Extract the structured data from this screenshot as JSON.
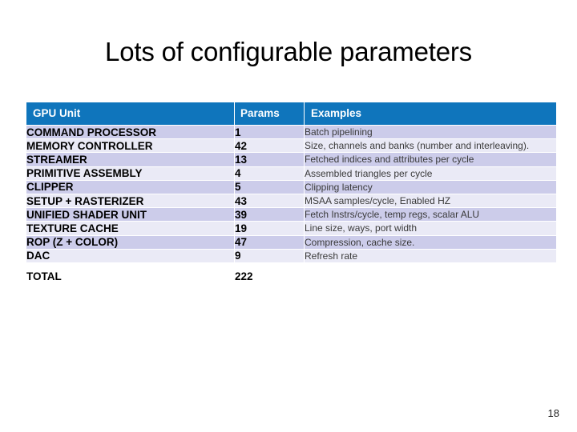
{
  "slide": {
    "title": "Lots of configurable parameters",
    "number": "18",
    "accent_color": "#0f75bc",
    "row_color_dark": "#ccccea",
    "row_color_light": "#eaeaf6"
  },
  "table": {
    "columns": [
      "GPU Unit",
      "Params",
      "Examples"
    ],
    "rows": [
      {
        "unit": "COMMAND PROCESSOR",
        "params": "1",
        "examples": "Batch pipelining"
      },
      {
        "unit": "MEMORY CONTROLLER",
        "params": "42",
        "examples": "Size, channels and banks (number and interleaving)."
      },
      {
        "unit": "STREAMER",
        "params": "13",
        "examples": "Fetched indices and attributes per cycle"
      },
      {
        "unit": "PRIMITIVE ASSEMBLY",
        "params": "4",
        "examples": "Assembled triangles per cycle"
      },
      {
        "unit": "CLIPPER",
        "params": "5",
        "examples": "Clipping latency"
      },
      {
        "unit": "SETUP + RASTERIZER",
        "params": "43",
        "examples": "MSAA samples/cycle, Enabled HZ"
      },
      {
        "unit": "UNIFIED SHADER UNIT",
        "params": "39",
        "examples": "Fetch Instrs/cycle, temp regs, scalar ALU"
      },
      {
        "unit": "TEXTURE CACHE",
        "params": "19",
        "examples": "Line size, ways, port width"
      },
      {
        "unit": "ROP (Z + COLOR)",
        "params": "47",
        "examples": "Compression, cache size."
      },
      {
        "unit": "DAC",
        "params": "9",
        "examples": "Refresh rate"
      }
    ],
    "total_row": {
      "unit": "TOTAL",
      "params": "222",
      "examples": ""
    }
  }
}
